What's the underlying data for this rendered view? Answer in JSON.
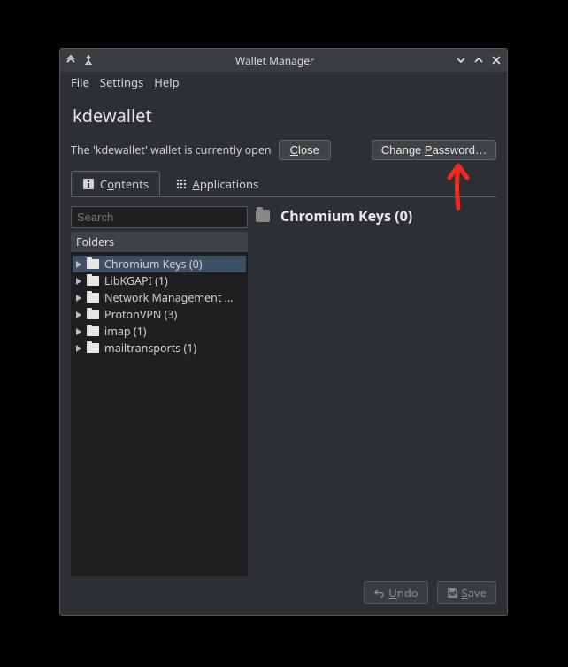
{
  "titlebar": {
    "title": "Wallet Manager"
  },
  "menu": {
    "file": "ile",
    "settings": "ettings",
    "help": "elp",
    "file_m": "F",
    "settings_m": "S",
    "help_m": "H"
  },
  "wallet": {
    "name": "kdewallet",
    "status_text": "The 'kdewallet' wallet is currently open",
    "close_label": "lose",
    "close_m": "C",
    "chpass_before": "Change ",
    "chpass_m": "P",
    "chpass_after": "assword…"
  },
  "tabs": {
    "contents_before": "C",
    "contents_m": "o",
    "contents_after": "ntents",
    "apps_before": "",
    "apps_m": "A",
    "apps_after": "pplications"
  },
  "search": {
    "placeholder": "Search"
  },
  "folders_header": "Folders",
  "folders": [
    {
      "name": "Chromium Keys (0)",
      "selected": true
    },
    {
      "name": "LibKGAPI (1)"
    },
    {
      "name": "Network Management ..."
    },
    {
      "name": "ProtonVPN (3)"
    },
    {
      "name": "imap (1)"
    },
    {
      "name": "mailtransports (1)"
    }
  ],
  "right": {
    "heading": "Chromium Keys (0)"
  },
  "footer": {
    "undo_before": "",
    "undo_m": "U",
    "undo_after": "ndo",
    "save_before": "",
    "save_m": "S",
    "save_after": "ave"
  }
}
